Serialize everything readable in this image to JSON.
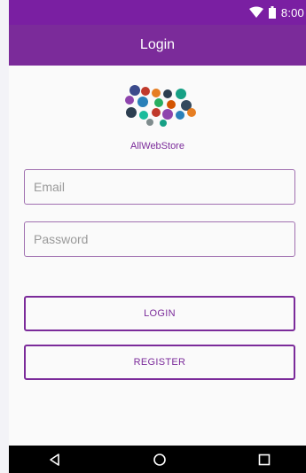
{
  "status_bar": {
    "time": "8:00"
  },
  "app_bar": {
    "title": "Login"
  },
  "brand": {
    "name": "AllWebStore"
  },
  "form": {
    "email_placeholder": "Email",
    "password_placeholder": "Password",
    "login_label": "LOGIN",
    "register_label": "REGISTER"
  },
  "colors": {
    "status_bar": "#7a1fa2",
    "app_bar": "#7b2b9a",
    "accent": "#7b2b9a"
  }
}
